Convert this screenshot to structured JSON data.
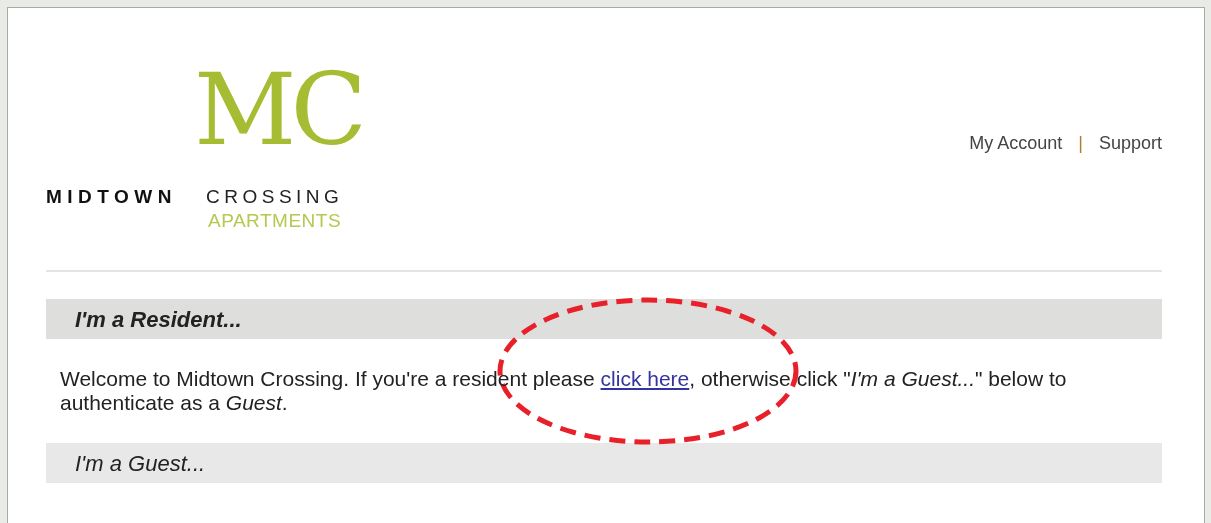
{
  "logo": {
    "monogram": "MC",
    "word_left": "MIDTOWN",
    "word_right": "CROSSING",
    "subtitle": "APARTMENTS"
  },
  "top_links": [
    {
      "label": "My Account"
    },
    {
      "label": "Support"
    }
  ],
  "separator": "|",
  "sections": [
    {
      "heading": "I'm a Resident...",
      "bold": true,
      "text_before": "Welcome to Midtown Crossing. If you're a resident please ",
      "link": "click here",
      "text_after": ", otherwise click \"*I'm a Guest...*\" below to authenticate as a *Guest*."
    },
    {
      "heading": "I'm a Guest...",
      "bold": false
    }
  ],
  "annotation": {
    "kind": "dashed-ellipse"
  }
}
